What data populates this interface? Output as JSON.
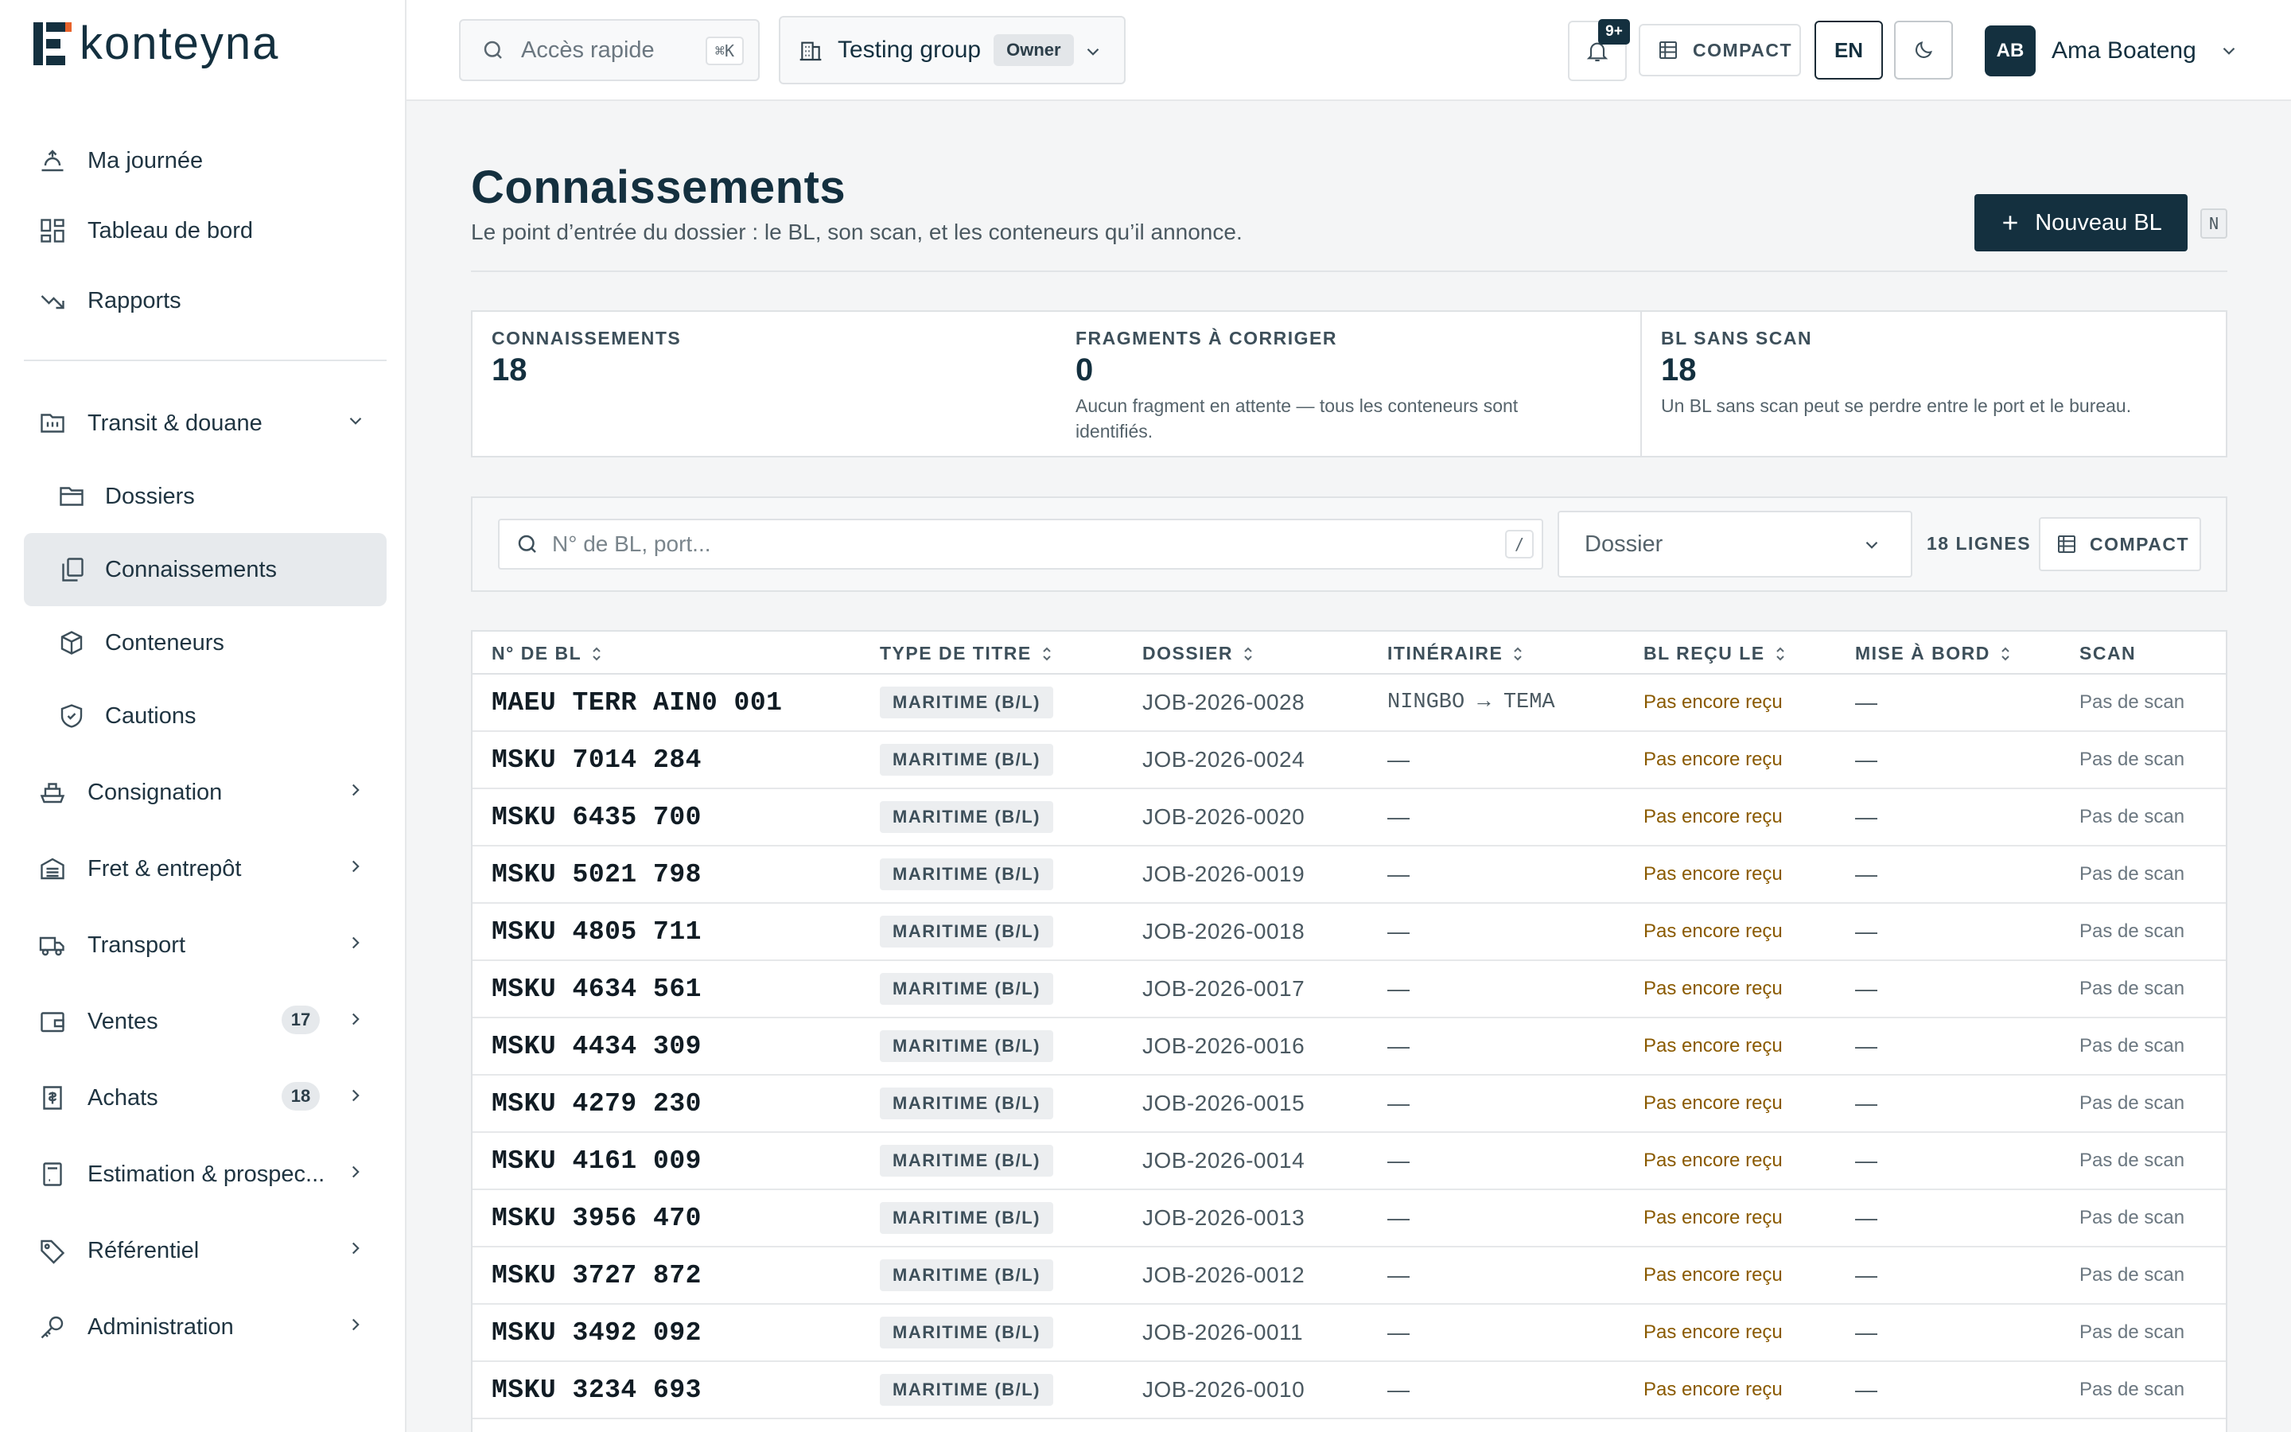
{
  "app": {
    "brand": "konteyna"
  },
  "topbar": {
    "quick_access": {
      "placeholder": "Accès rapide",
      "shortcut": "⌘K"
    },
    "group": {
      "name": "Testing group",
      "role": "Owner"
    },
    "notifications": {
      "badge": "9+"
    },
    "compact_label": "COMPACT",
    "language": "EN",
    "user": {
      "initials": "AB",
      "name": "Ama Boateng"
    }
  },
  "sidebar": {
    "top_items": [
      {
        "label": "Ma journée",
        "icon": "day-icon"
      },
      {
        "label": "Tableau de bord",
        "icon": "dashboard-icon"
      },
      {
        "label": "Rapports",
        "icon": "trend-icon"
      }
    ],
    "transit": {
      "label": "Transit & douane",
      "children": [
        {
          "label": "Dossiers",
          "icon": "folder-icon"
        },
        {
          "label": "Connaissements",
          "icon": "copy-icon",
          "active": true
        },
        {
          "label": "Conteneurs",
          "icon": "box-icon"
        },
        {
          "label": "Cautions",
          "icon": "shield-icon"
        }
      ]
    },
    "groups": [
      {
        "label": "Consignation",
        "icon": "ship-icon",
        "count": ""
      },
      {
        "label": "Fret & entrepôt",
        "icon": "warehouse-icon",
        "count": ""
      },
      {
        "label": "Transport",
        "icon": "truck-icon",
        "count": ""
      },
      {
        "label": "Ventes",
        "icon": "wallet-icon",
        "count": "17"
      },
      {
        "label": "Achats",
        "icon": "receipt-icon",
        "count": "18"
      },
      {
        "label": "Estimation & prospec...",
        "icon": "calculator-icon",
        "count": ""
      },
      {
        "label": "Référentiel",
        "icon": "tag-icon",
        "count": ""
      },
      {
        "label": "Administration",
        "icon": "key-icon",
        "count": ""
      }
    ]
  },
  "page": {
    "title": "Connaissements",
    "subtitle": "Le point d’entrée du dossier : le BL, son scan, et les conteneurs qu’il annonce.",
    "new_button": "Nouveau BL",
    "new_shortcut": "N"
  },
  "stats": [
    {
      "label": "CONNAISSEMENTS",
      "value": "18",
      "note": ""
    },
    {
      "label": "FRAGMENTS À CORRIGER",
      "value": "0",
      "note": "Aucun fragment en attente — tous les conteneurs sont identifiés."
    },
    {
      "label": "BL SANS SCAN",
      "value": "18",
      "note": "Un BL sans scan peut se perdre entre le port et le bureau."
    }
  ],
  "filters": {
    "search_placeholder": "N° de BL, port...",
    "search_shortcut": "/",
    "dossier_placeholder": "Dossier",
    "row_count": "18 LIGNES",
    "compact_label": "COMPACT"
  },
  "table": {
    "columns": [
      "N° DE BL",
      "TYPE DE TITRE",
      "DOSSIER",
      "ITINÉRAIRE",
      "BL REÇU LE",
      "MISE À BORD",
      "SCAN"
    ],
    "rows": [
      {
        "bl": "MAEU TERR AIN0 001",
        "type": "MARITIME (B/L)",
        "dossier": "JOB-2026-0028",
        "itineraire": "NINGBO → TEMA",
        "recu": "Pas encore reçu",
        "bord": "—",
        "scan": "Pas de scan"
      },
      {
        "bl": "MSKU 7014 284",
        "type": "MARITIME (B/L)",
        "dossier": "JOB-2026-0024",
        "itineraire": "—",
        "recu": "Pas encore reçu",
        "bord": "—",
        "scan": "Pas de scan"
      },
      {
        "bl": "MSKU 6435 700",
        "type": "MARITIME (B/L)",
        "dossier": "JOB-2026-0020",
        "itineraire": "—",
        "recu": "Pas encore reçu",
        "bord": "—",
        "scan": "Pas de scan"
      },
      {
        "bl": "MSKU 5021 798",
        "type": "MARITIME (B/L)",
        "dossier": "JOB-2026-0019",
        "itineraire": "—",
        "recu": "Pas encore reçu",
        "bord": "—",
        "scan": "Pas de scan"
      },
      {
        "bl": "MSKU 4805 711",
        "type": "MARITIME (B/L)",
        "dossier": "JOB-2026-0018",
        "itineraire": "—",
        "recu": "Pas encore reçu",
        "bord": "—",
        "scan": "Pas de scan"
      },
      {
        "bl": "MSKU 4634 561",
        "type": "MARITIME (B/L)",
        "dossier": "JOB-2026-0017",
        "itineraire": "—",
        "recu": "Pas encore reçu",
        "bord": "—",
        "scan": "Pas de scan"
      },
      {
        "bl": "MSKU 4434 309",
        "type": "MARITIME (B/L)",
        "dossier": "JOB-2026-0016",
        "itineraire": "—",
        "recu": "Pas encore reçu",
        "bord": "—",
        "scan": "Pas de scan"
      },
      {
        "bl": "MSKU 4279 230",
        "type": "MARITIME (B/L)",
        "dossier": "JOB-2026-0015",
        "itineraire": "—",
        "recu": "Pas encore reçu",
        "bord": "—",
        "scan": "Pas de scan"
      },
      {
        "bl": "MSKU 4161 009",
        "type": "MARITIME (B/L)",
        "dossier": "JOB-2026-0014",
        "itineraire": "—",
        "recu": "Pas encore reçu",
        "bord": "—",
        "scan": "Pas de scan"
      },
      {
        "bl": "MSKU 3956 470",
        "type": "MARITIME (B/L)",
        "dossier": "JOB-2026-0013",
        "itineraire": "—",
        "recu": "Pas encore reçu",
        "bord": "—",
        "scan": "Pas de scan"
      },
      {
        "bl": "MSKU 3727 872",
        "type": "MARITIME (B/L)",
        "dossier": "JOB-2026-0012",
        "itineraire": "—",
        "recu": "Pas encore reçu",
        "bord": "—",
        "scan": "Pas de scan"
      },
      {
        "bl": "MSKU 3492 092",
        "type": "MARITIME (B/L)",
        "dossier": "JOB-2026-0011",
        "itineraire": "—",
        "recu": "Pas encore reçu",
        "bord": "—",
        "scan": "Pas de scan"
      },
      {
        "bl": "MSKU 3234 693",
        "type": "MARITIME (B/L)",
        "dossier": "JOB-2026-0010",
        "itineraire": "—",
        "recu": "Pas encore reçu",
        "bord": "—",
        "scan": "Pas de scan"
      }
    ]
  },
  "colors": {
    "brand": "#14303f",
    "pending": "#8a5a00",
    "active_nav": "#e7eaed"
  }
}
